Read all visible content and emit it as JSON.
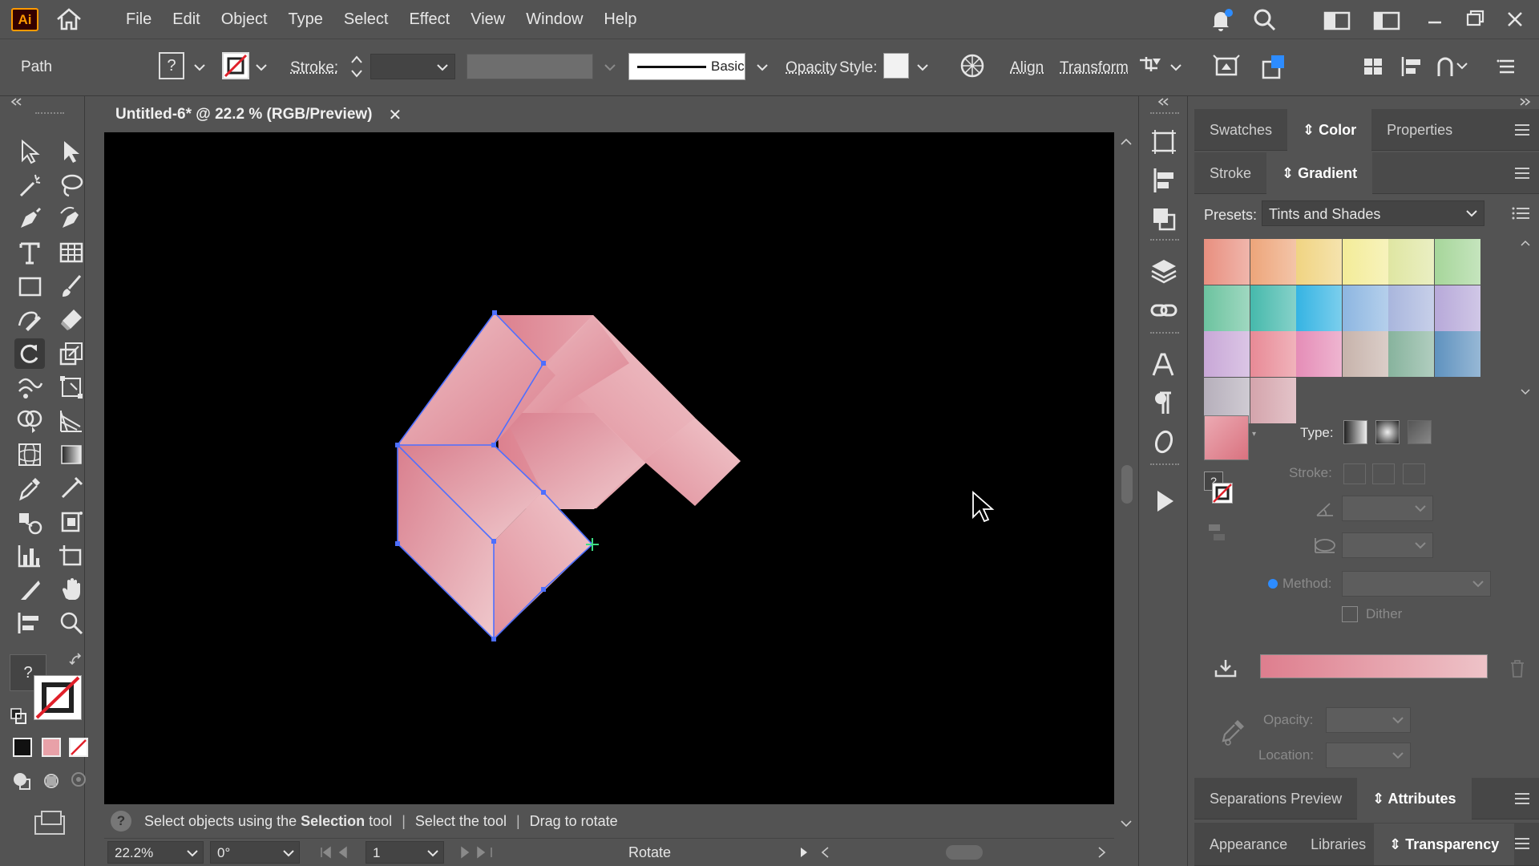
{
  "app": {
    "logo": "Ai"
  },
  "menu": [
    "File",
    "Edit",
    "Object",
    "Type",
    "Select",
    "Effect",
    "View",
    "Window",
    "Help"
  ],
  "control": {
    "selection_type": "Path",
    "stroke_label": "Stroke:",
    "brush_label": "Basic",
    "opacity_label": "Opacity",
    "style_label": "Style:",
    "align_label": "Align",
    "transform_label": "Transform"
  },
  "document": {
    "tab_title": "Untitled-6* @ 22.2 % (RGB/Preview)",
    "close_glyph": "✕"
  },
  "hint": {
    "icon": "?",
    "part1": "Select objects using the ",
    "part1_bold": "Selection",
    "part1_end": " tool",
    "sep": "|",
    "part2": "Select the tool",
    "part3": "Drag to rotate"
  },
  "status": {
    "zoom": "22.2%",
    "angle": "0°",
    "artboard": "1",
    "tool": "Rotate"
  },
  "panels": {
    "top_tabs": [
      "Swatches",
      "Color",
      "Properties"
    ],
    "top_active": "Color",
    "grad_tabs": [
      "Stroke",
      "Gradient"
    ],
    "grad_active": "Gradient",
    "presets_label": "Presets:",
    "presets_value": "Tints and Shades",
    "type_label": "Type:",
    "stroke_label": "Stroke:",
    "method_label": "Method:",
    "dither_label": "Dither",
    "opacity_label": "Opacity:",
    "location_label": "Location:",
    "mid_tabs": [
      "Separations Preview",
      "Attributes"
    ],
    "mid_active": "Attributes",
    "bottom_tabs": [
      "Appearance",
      "Libraries",
      "Transparency"
    ],
    "bottom_active": "Transparency"
  },
  "swatches": [
    [
      "#e88f7f",
      "#eda57a",
      "#f0d482",
      "#f3ec98",
      "#dfe6a2",
      "#a6d69a"
    ],
    [
      "#6cc39f",
      "#46b9ac",
      "#35b4e3",
      "#8db6e1",
      "#a9b6dd",
      "#b7a9d9"
    ],
    [
      "#c8a7d7",
      "#e88a96",
      "#e58db7",
      "#c7b3ab",
      "#87b39d",
      "#5f92bf"
    ],
    [
      "#b6afbb",
      "#d4a4ac"
    ]
  ],
  "colors": {
    "gradient_start": "#de7e8e",
    "gradient_end": "#eec3c8",
    "selection": "#4e6fff"
  }
}
